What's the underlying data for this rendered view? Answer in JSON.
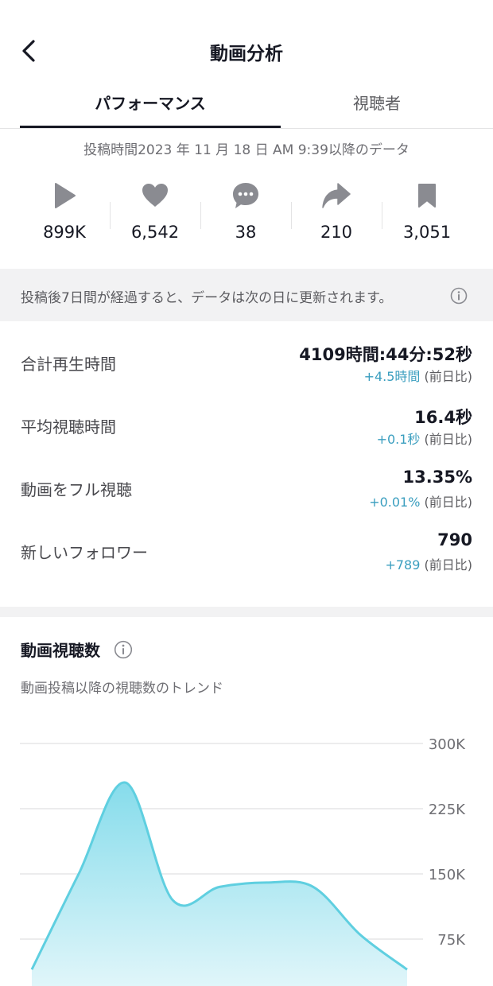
{
  "header": {
    "title": "動画分析"
  },
  "tabs": [
    {
      "label": "パフォーマンス",
      "active": true
    },
    {
      "label": "視聴者",
      "active": false
    }
  ],
  "since_text": "投稿時間2023 年 11 月 18 日 AM 9:39以降のデータ",
  "stats": [
    {
      "icon": "play-icon",
      "value": "899K"
    },
    {
      "icon": "heart-icon",
      "value": "6,542"
    },
    {
      "icon": "comment-icon",
      "value": "38"
    },
    {
      "icon": "share-icon",
      "value": "210"
    },
    {
      "icon": "bookmark-icon",
      "value": "3,051"
    }
  ],
  "notice": "投稿後7日間が経過すると、データは次の日に更新されます。",
  "metrics": [
    {
      "label": "合計再生時間",
      "value": "4109時間:44分:52秒",
      "delta": "+4.5時間",
      "delta_suffix": " (前日比)"
    },
    {
      "label": "平均視聴時間",
      "value": "16.4秒",
      "delta": "+0.1秒",
      "delta_suffix": " (前日比)"
    },
    {
      "label": "動画をフル視聴",
      "value": "13.35%",
      "delta": "+0.01%",
      "delta_suffix": " (前日比)"
    },
    {
      "label": "新しいフォロワー",
      "value": "790",
      "delta": "+789",
      "delta_suffix": " (前日比)"
    }
  ],
  "views_chart": {
    "title": "動画視聴数",
    "subtitle": "動画投稿以降の視聴数のトレンド"
  },
  "colors": {
    "accent": "#3a9ebf",
    "line": "#5fcfe0",
    "fill_top": "#86dceb",
    "fill_bottom": "#e8f8fb"
  },
  "chart_data": {
    "type": "area",
    "title": "動画視聴数",
    "subtitle": "動画投稿以降の視聴数のトレンド",
    "y_ticks": [
      "300K",
      "225K",
      "150K",
      "75K"
    ],
    "y_tick_values": [
      300000,
      225000,
      150000,
      75000
    ],
    "ylim": [
      0,
      300000
    ],
    "grid": true,
    "series": [
      {
        "values": [
          40000,
          150000,
          255000,
          120000,
          135000,
          140000,
          135000,
          80000,
          40000
        ]
      }
    ]
  }
}
